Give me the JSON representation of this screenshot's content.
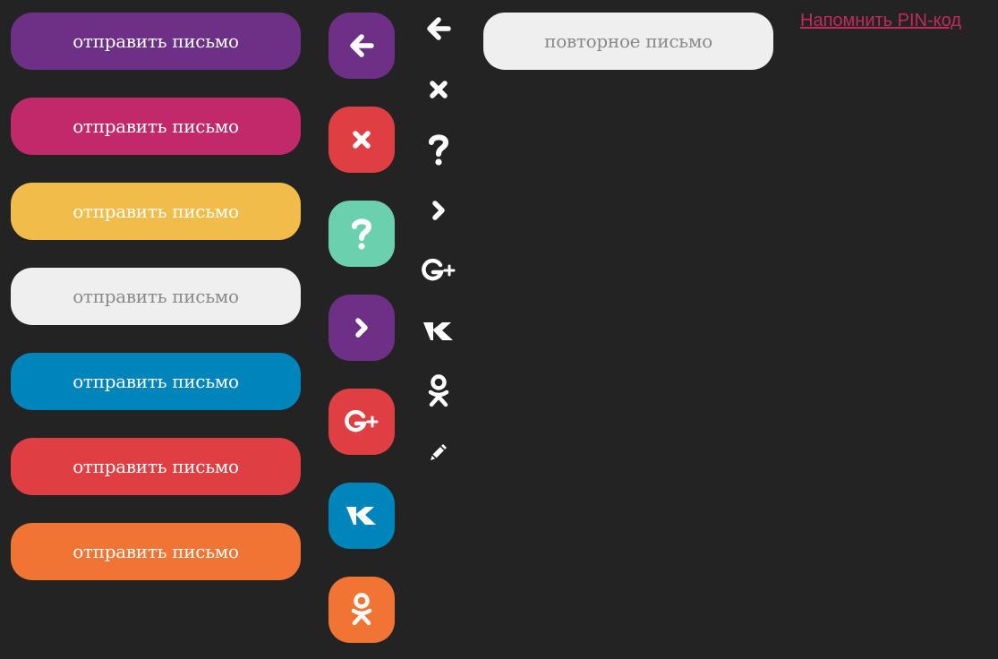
{
  "send_buttons": [
    {
      "label": "отправить письмо",
      "color": "#6e2f87"
    },
    {
      "label": "отправить письмо",
      "color": "#c2296a"
    },
    {
      "label": "отправить письмо",
      "color": "#f2bc4b"
    },
    {
      "label": "отправить письмо",
      "color": "#efefef"
    },
    {
      "label": "отправить письмо",
      "color": "#0085ba"
    },
    {
      "label": "отправить письмо",
      "color": "#df3e42"
    },
    {
      "label": "отправить письмо",
      "color": "#f07433"
    }
  ],
  "icon_buttons": [
    {
      "icon": "arrow-left-icon",
      "color": "#6e2f87"
    },
    {
      "icon": "close-icon",
      "color": "#df3e42"
    },
    {
      "icon": "question-icon",
      "color": "#6bd0ae"
    },
    {
      "icon": "chevron-right-icon",
      "color": "#6e2f87"
    },
    {
      "icon": "google-plus-icon",
      "color": "#df3e42"
    },
    {
      "icon": "vk-icon",
      "color": "#0085ba"
    },
    {
      "icon": "odnoklassniki-icon",
      "color": "#f07433"
    }
  ],
  "bare_icons": [
    {
      "icon": "arrow-left-icon"
    },
    {
      "icon": "close-icon"
    },
    {
      "icon": "question-icon"
    },
    {
      "icon": "chevron-right-icon"
    },
    {
      "icon": "google-plus-icon"
    },
    {
      "icon": "vk-icon"
    },
    {
      "icon": "odnoklassniki-icon"
    },
    {
      "icon": "pencil-icon"
    }
  ],
  "resend_button": {
    "label": "повторное письмо"
  },
  "pin_link": {
    "label": "Напомнить PIN-код"
  }
}
